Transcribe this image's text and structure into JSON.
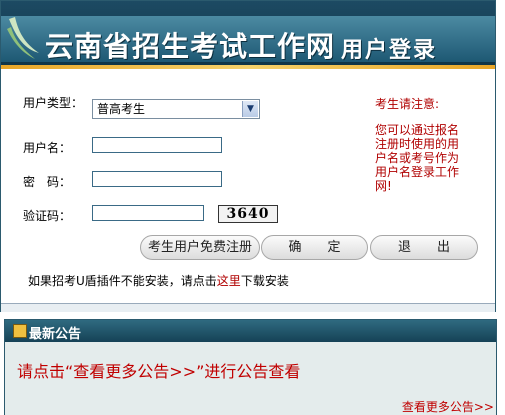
{
  "banner": {
    "title": "云南省招生考试工作网",
    "subtitle": "用户登录"
  },
  "form": {
    "user_type_label": "用户类型：",
    "user_type_value": "普高考生",
    "username_label": "用户名：",
    "username_value": "",
    "password_label": "密　码：",
    "password_value": "",
    "captcha_label": "验证码：",
    "captcha_value": "",
    "captcha_code": "3640"
  },
  "buttons": {
    "register": "考生用户免费注册",
    "confirm": "确　　定",
    "exit": "退　　出"
  },
  "notice": {
    "title": "考生请注意:",
    "body": "您可以通过报名注册时使用的用户名或考号作为用户名登录工作网!"
  },
  "hint": {
    "text_before": "如果招考U盾插件不能安装，请点击",
    "link": "这里",
    "text_after": "下载安装"
  },
  "news": {
    "title": "最新公告",
    "message": "请点击“查看更多公告>>”进行公告查看",
    "more_link": "查看更多公告>>"
  },
  "colors": {
    "banner_bg": "#1e5873",
    "accent": "#e8a628",
    "notice_text": "#b00000"
  }
}
